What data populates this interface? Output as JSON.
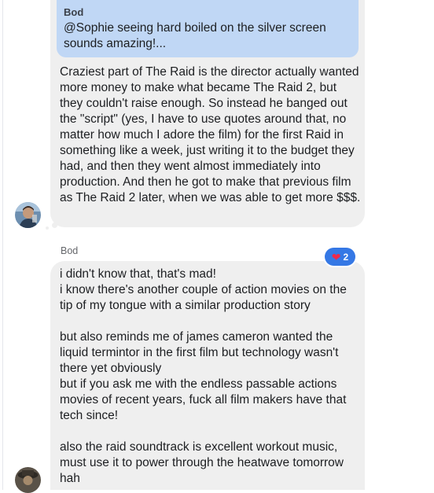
{
  "quote": {
    "author": "Bod",
    "text": "@Sophie seeing hard boiled on the silver screen sounds amazing!..."
  },
  "messages": [
    {
      "text": "Craziest part of The Raid is the director actually wanted more money to make what became The Raid 2, but they couldn't raise enough. So instead he banged out the \"script\" (yes, I have to use quotes around that, no matter how much I adore the film) for the first Raid in something like a week, just writing it to the budget they had, and then they went almost immediately into production. And then he got to make that previous film as The Raid 2 later, when we was able to get more $$$."
    },
    {
      "sender": "Bod",
      "reaction": {
        "icon": "heart-icon",
        "count": "2"
      },
      "text": "i didn't know that, that's mad!\ni know there's another couple of action movies on the tip of my tongue with a similar production story\n\nbut also reminds me of james cameron wanted the liquid termintor in the first film but technology wasn't there yet obviously\nbut if you ask me with the endless passable actions movies of recent years, fuck all film makers have that tech since!\n\nalso the raid soundtrack is excellent workout music, must use it to power through the heatwave tomorrow hah"
    }
  ],
  "colors": {
    "bubble": "#efefef",
    "quote": "#c0d7f5",
    "reaction": "#3578e5"
  }
}
